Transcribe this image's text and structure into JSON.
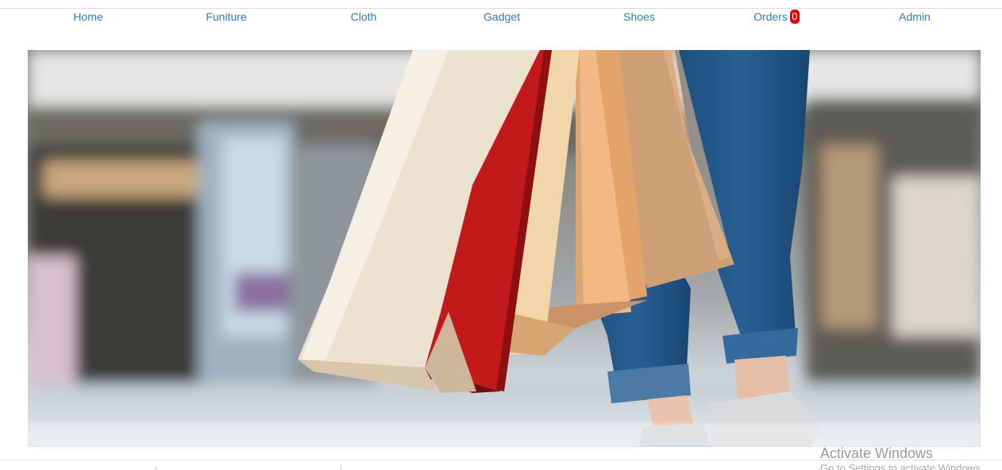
{
  "nav": {
    "home": "Home",
    "furniture": "Funiture",
    "cloth": "Cloth",
    "gadget": "Gadget",
    "shoes": "Shoes",
    "orders": "Orders",
    "orders_count": "0",
    "admin": "Admin"
  },
  "hero": {
    "image": "shopping-bags-banner"
  },
  "watermark": {
    "title": "Activate Windows",
    "subtitle": "Go to Settings to activate Windows."
  },
  "colors": {
    "link": "#337ab7",
    "badge": "#e60000"
  }
}
